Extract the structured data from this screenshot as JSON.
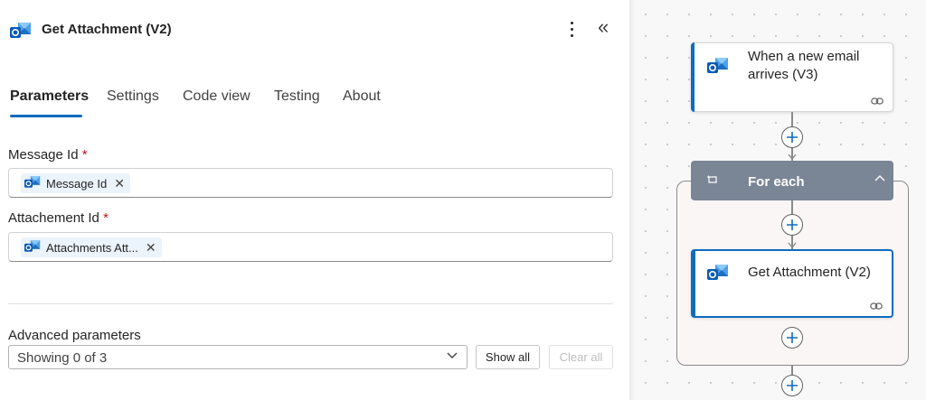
{
  "panel": {
    "title": "Get Attachment (V2)",
    "tabs": [
      {
        "label": "Parameters",
        "active": true
      },
      {
        "label": "Settings",
        "active": false
      },
      {
        "label": "Code view",
        "active": false
      },
      {
        "label": "Testing",
        "active": false
      },
      {
        "label": "About",
        "active": false
      }
    ],
    "fields": [
      {
        "label": "Message Id",
        "required_mark": "*",
        "token": "Message Id"
      },
      {
        "label": "Attachement Id",
        "required_mark": "*",
        "token": "Attachments Att..."
      }
    ],
    "advanced": {
      "label": "Advanced parameters",
      "select_value": "Showing 0 of 3",
      "show_all": "Show all",
      "clear_all": "Clear all"
    }
  },
  "canvas": {
    "trigger": {
      "title_line1": "When a new email",
      "title_line2": "arrives (V3)"
    },
    "loop": {
      "title": "For each"
    },
    "action": {
      "title": "Get Attachment (V2)"
    }
  },
  "colors": {
    "accent": "#0f6cbd",
    "required": "#c50f1f",
    "loop_header": "#7a8596",
    "token_bg": "#ebf3fc"
  },
  "icons": [
    "outlook-icon",
    "more-vertical-icon",
    "collapse-left-icon",
    "close-icon",
    "chevron-down-icon",
    "link-icon",
    "loop-icon",
    "chevron-up-icon",
    "plus-icon",
    "arrow-down-icon"
  ]
}
